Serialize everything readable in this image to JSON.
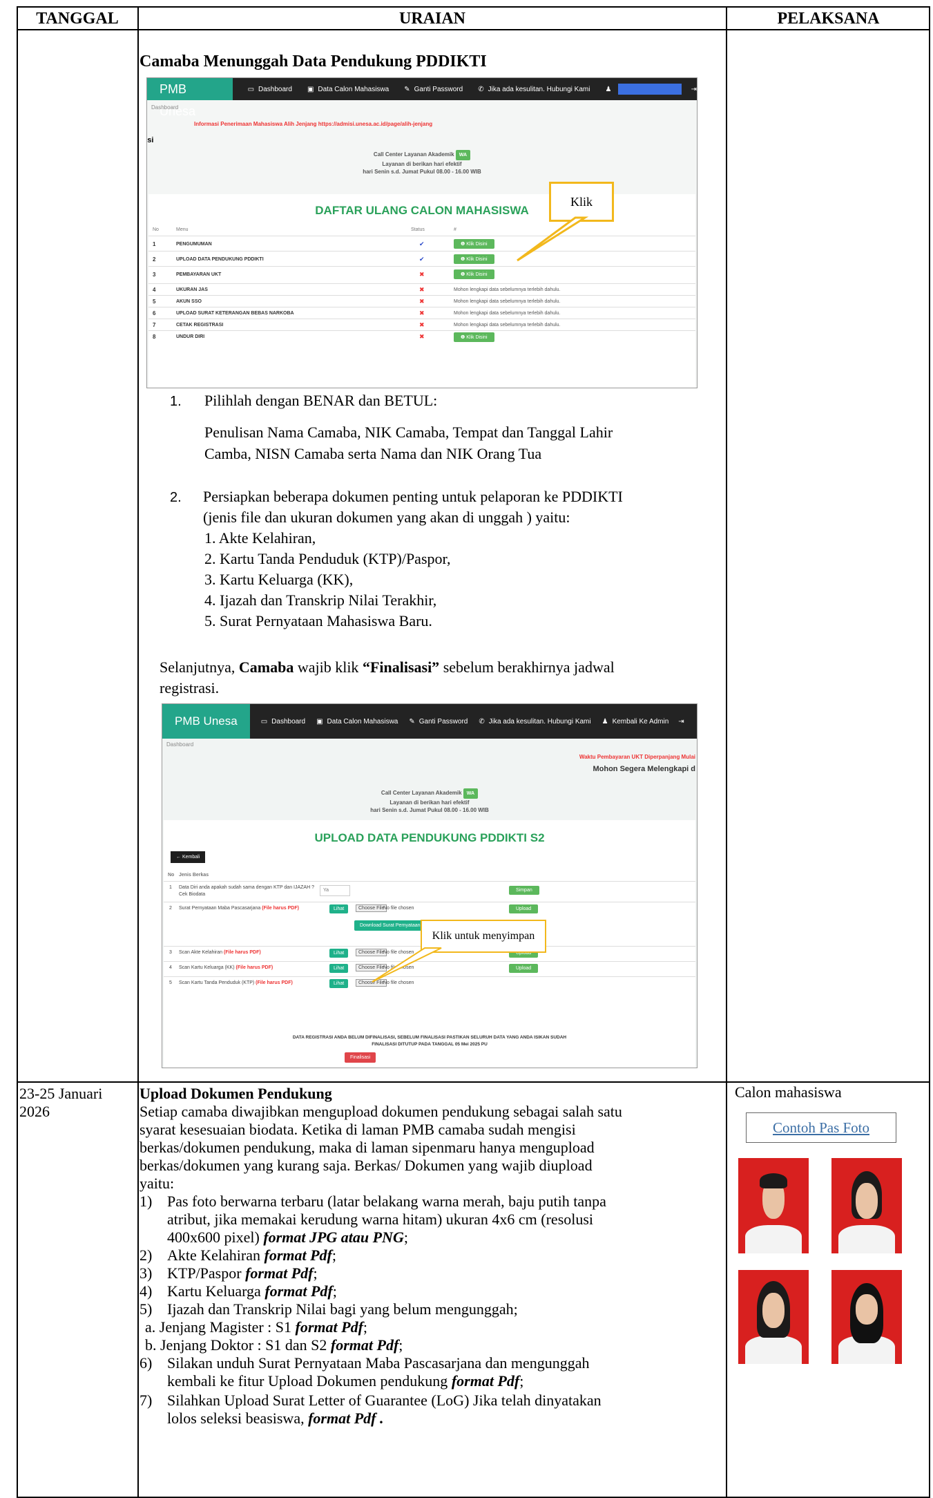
{
  "header": {
    "col1": "TANGGAL",
    "col2": "URAIAN",
    "col3": "PELAKSANA"
  },
  "row1": {
    "heading": "Camaba Menunggah Data Pendukung PDDIKTI",
    "screenshot1": {
      "brand": "PMB Unesa",
      "nav": [
        "Dashboard",
        "Data Calon Mahasiswa",
        "Ganti Password",
        "Jika ada kesulitan. Hubungi Kami"
      ],
      "breadcrumb": "Dashboard",
      "info": "Informasi Penerimaan Mahasiswa Alih Jenjang https://admisi.unesa.ac.id/page/alih-jenjang",
      "side_text": "eksi",
      "call_center": "Call Center Layanan Akademik",
      "wa": "WA",
      "service1": "Layanan di berikan hari efektif",
      "service2": "hari Senin s.d. Jumat Pukul 08.00 - 16.00 WIB",
      "title": "DAFTAR ULANG CALON MAHASISWA",
      "col_no": "No",
      "col_menu": "Menu",
      "col_status": "Status",
      "col_hash": "#",
      "rows": [
        {
          "no": "1",
          "menu": "PENGUMUMAN",
          "status": "✔",
          "ok": true,
          "action": "Klik Disini"
        },
        {
          "no": "2",
          "menu": "UPLOAD DATA PENDUKUNG PDDIKTI",
          "status": "✔",
          "ok": true,
          "action": "Klik Disini"
        },
        {
          "no": "3",
          "menu": "PEMBAYARAN UKT",
          "status": "✖",
          "ok": false,
          "action": "Klik Disini"
        },
        {
          "no": "4",
          "menu": "UKURAN JAS",
          "status": "✖",
          "ok": false,
          "action": "Mohon lengkapi data sebelumnya terlebih dahulu."
        },
        {
          "no": "5",
          "menu": "AKUN SSO",
          "status": "✖",
          "ok": false,
          "action": "Mohon lengkapi data sebelumnya terlebih dahulu."
        },
        {
          "no": "6",
          "menu": "UPLOAD SURAT KETERANGAN BEBAS NARKOBA",
          "status": "✖",
          "ok": false,
          "action": "Mohon lengkapi data sebelumnya terlebih dahulu."
        },
        {
          "no": "7",
          "menu": "CETAK REGISTRASI",
          "status": "✖",
          "ok": false,
          "action": "Mohon lengkapi data sebelumnya terlebih dahulu."
        },
        {
          "no": "8",
          "menu": "UNDUR DIRI",
          "status": "✖",
          "ok": false,
          "action": "Klik Disini"
        }
      ],
      "callout": "Klik"
    },
    "point1_num": "1.",
    "point1_title": "Pilihlah dengan BENAR dan BETUL:",
    "point1_body_1": "Penulisan Nama Camaba, NIK Camaba, Tempat dan Tanggal Lahir",
    "point1_body_2": "Camba, NISN Camaba serta Nama dan NIK Orang Tua",
    "point2_num": "2.",
    "point2_line1": "Persiapkan beberapa dokumen penting untuk pelaporan ke PDDIKTI",
    "point2_line2": "(jenis file dan ukuran dokumen yang akan di unggah ) yaitu:",
    "docs": [
      "1. Akte Kelahiran,",
      "2. Kartu Tanda Penduduk (KTP)/Paspor,",
      "3. Kartu Keluarga (KK),",
      "4. Ijazah dan Transkrip Nilai Terakhir,",
      "5. Surat Pernyataan Mahasiswa Baru."
    ],
    "final_a": "Selanjutnya, ",
    "final_b": "Camaba",
    "final_c": " wajib klik ",
    "final_d": "“Finalisasi”",
    "final_e": " sebelum berakhirnya jadwal",
    "final_f": "registrasi.",
    "screenshot2": {
      "brand": "PMB Unesa",
      "nav": [
        "Dashboard",
        "Data Calon Mahasiswa",
        "Ganti Password",
        "Jika ada kesulitan. Hubungi Kami",
        "Kembali Ke Admin"
      ],
      "breadcrumb": "Dashboard",
      "notice_red": "Waktu Pembayaran UKT Diperpanjang Mulai",
      "notice_dark": "Mohon Segera Melengkapi d",
      "call_center": "Call Center Layanan Akademik",
      "wa": "WA",
      "service1": "Layanan di berikan hari efektif",
      "service2": "hari Senin s.d. Jumat Pukul 08.00 - 16.00 WIB",
      "title": "UPLOAD DATA PENDUKUNG PDDIKTI S2",
      "back": "Kembali",
      "col_no": "No",
      "col_jenis": "Jenis Berkas",
      "row1_no": "1",
      "row1_text": "Data Diri anda apakah sudah sama dengan KTP dan IJAZAH ?",
      "row1_sub": "Cek Biodata",
      "row1_val": "Ya",
      "row1_btn": "Simpan",
      "file_rows": [
        {
          "no": "2",
          "text": "Surat Pernyataan Maba Pascasarjana",
          "red": "(File harus PDF)"
        },
        {
          "no": "3",
          "text": "Scan Akte Kelahiran",
          "red": "(File harus PDF)"
        },
        {
          "no": "4",
          "text": "Scan Kartu Keluarga (KK)",
          "red": "(File harus PDF)"
        },
        {
          "no": "5",
          "text": "Scan Kartu Tanda Penduduk (KTP)",
          "red": "(File harus PDF)"
        }
      ],
      "lihat": "Lihat",
      "choose": "Choose File",
      "nofile": "No file chosen",
      "upload": "Upload",
      "download": "Download Surat Pernyataan Maba Pascasarjana",
      "warn1": "DATA REGISTRASI ANDA BELUM DIFINALISASI, SEBELUM FINALISASI PASTIKAN SELURUH DATA YANG ANDA ISIKAN SUDAH",
      "warn2": "FINALISASI DITUTUP PADA TANGGAL 05 Mei 2025 PU",
      "finalisasi": "Finalisasi",
      "callout": "Klik untuk menyimpan"
    }
  },
  "row2": {
    "date_1": "23-25 Januari",
    "date_2": "2026",
    "heading": "Upload Dokumen Pendukung",
    "intro": [
      "Setiap camaba diwajibkan mengupload dokumen pendukung sebagai salah satu",
      "syarat kesesuaian biodata. Ketika di laman PMB camaba sudah mengisi",
      "berkas/dokumen pendukung, maka di laman sipenmaru hanya mengupload",
      "berkas/dokumen yang kurang saja. Berkas/ Dokumen yang wajib diupload",
      "yaitu:"
    ],
    "i1_num": "1)",
    "i1_l1": "Pas foto berwarna terbaru (latar belakang warna merah, baju putih tanpa",
    "i1_l2": "atribut, jika memakai kerudung warna hitam) ukuran 4x6 cm (resolusi",
    "i1_l3a": "400x600 pixel) ",
    "i1_l3b": "format JPG atau PNG",
    "i1_l3c": ";",
    "i2_num": "2)",
    "i2_a": "Akte Kelahiran  ",
    "i2_b": "format Pdf",
    "i2_c": ";",
    "i3_num": "3)",
    "i3_a": "KTP/Paspor  ",
    "i3_b": "format Pdf",
    "i3_c": ";",
    "i4_num": "4)",
    "i4_a": "Kartu Keluarga  ",
    "i4_b": "format Pdf",
    "i4_c": ";",
    "i5_num": "5)",
    "i5_a": "Ijazah dan Transkrip Nilai bagi yang belum mengunggah;",
    "i5a_a": "a. Jenjang Magister : S1 ",
    "i5a_b": "format Pdf",
    "i5a_c": ";",
    "i5b_a": "b. Jenjang Doktor : S1 dan S2  ",
    "i5b_b": "format Pdf",
    "i5b_c": ";",
    "i6_num": "6)",
    "i6_l1": "Silakan unduh Surat Pernyataan Maba Pascasarjana dan mengunggah",
    "i6_l2a": "kembali ke fitur Upload Dokumen pendukung ",
    "i6_l2b": "format Pdf",
    "i6_l2c": ";",
    "i7_num": "7)",
    "i7_l1": "Silahkan Upload Surat Letter of Guarantee (LoG) Jika telah dinyatakan",
    "i7_l2a": "lolos seleksi beasiswa, ",
    "i7_l2b": "format Pdf .",
    "pelaksana": "Calon mahasiswa",
    "photo_caption": "Contoh Pas Foto"
  }
}
